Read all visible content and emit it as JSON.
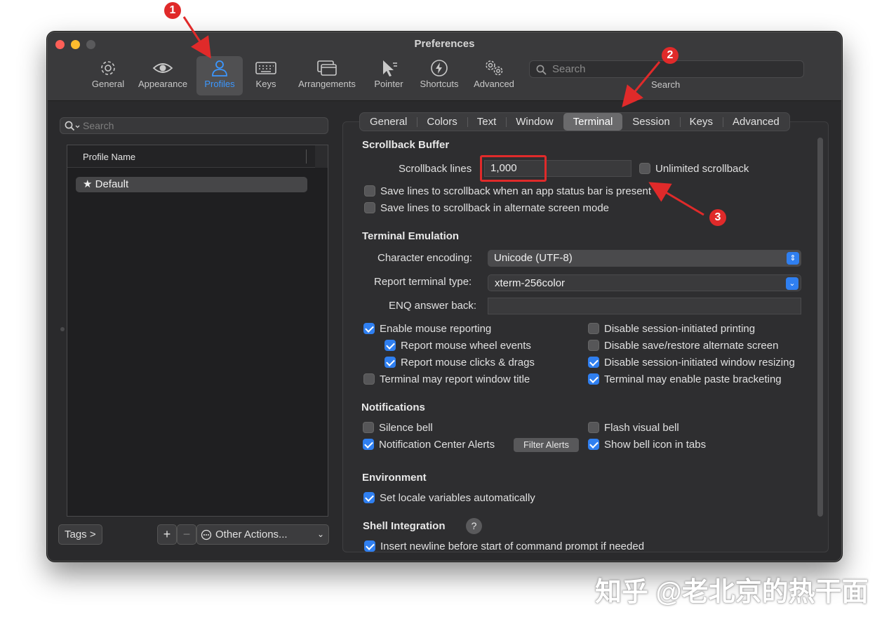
{
  "window": {
    "title": "Preferences"
  },
  "toolbar": {
    "items": [
      {
        "label": "General",
        "icon": "gear-icon"
      },
      {
        "label": "Appearance",
        "icon": "eye-icon"
      },
      {
        "label": "Profiles",
        "icon": "person-icon"
      },
      {
        "label": "Keys",
        "icon": "keyboard-icon"
      },
      {
        "label": "Arrangements",
        "icon": "windows-icon"
      },
      {
        "label": "Pointer",
        "icon": "cursor-icon"
      },
      {
        "label": "Shortcuts",
        "icon": "bolt-icon"
      },
      {
        "label": "Advanced",
        "icon": "gears-icon"
      }
    ],
    "search_placeholder": "Search",
    "search_label": "Search"
  },
  "sidebar": {
    "search_placeholder": "Search",
    "column_header": "Profile Name",
    "profile": "★ Default",
    "tags_button": "Tags >",
    "add_button": "+",
    "remove_button": "−",
    "other_actions": "Other Actions..."
  },
  "tabs": [
    "General",
    "Colors",
    "Text",
    "Window",
    "Terminal",
    "Session",
    "Keys",
    "Advanced"
  ],
  "scrollback": {
    "title": "Scrollback Buffer",
    "lines_label": "Scrollback lines",
    "lines_value": "1,000",
    "unlimited": "Unlimited scrollback",
    "save_status_bar": "Save lines to scrollback when an app status bar is present",
    "save_alternate": "Save lines to scrollback in alternate screen mode"
  },
  "emulation": {
    "title": "Terminal Emulation",
    "encoding_label": "Character encoding:",
    "encoding_value": "Unicode (UTF-8)",
    "type_label": "Report terminal type:",
    "type_value": "xterm-256color",
    "enq_label": "ENQ answer back:",
    "left": [
      "Enable mouse reporting",
      "Report mouse wheel events",
      "Report mouse clicks & drags",
      "Terminal may report window title"
    ],
    "right": [
      "Disable session-initiated printing",
      "Disable save/restore alternate screen",
      "Disable session-initiated window resizing",
      "Terminal may enable paste bracketing"
    ]
  },
  "notifications": {
    "title": "Notifications",
    "silence": "Silence bell",
    "nc_alerts": "Notification Center Alerts",
    "filter_button": "Filter Alerts",
    "flash": "Flash visual bell",
    "bell_icon": "Show bell icon in tabs"
  },
  "environment": {
    "title": "Environment",
    "locale": "Set locale variables automatically"
  },
  "shell": {
    "title": "Shell Integration",
    "help": "?",
    "newline": "Insert newline before start of command prompt if needed"
  },
  "annotations": {
    "b1": "1",
    "b2": "2",
    "b3": "3"
  },
  "watermark": "知乎 @老北京的热干面",
  "colors": {
    "accent": "#2f7ff0",
    "annotation": "#e02a2a"
  }
}
